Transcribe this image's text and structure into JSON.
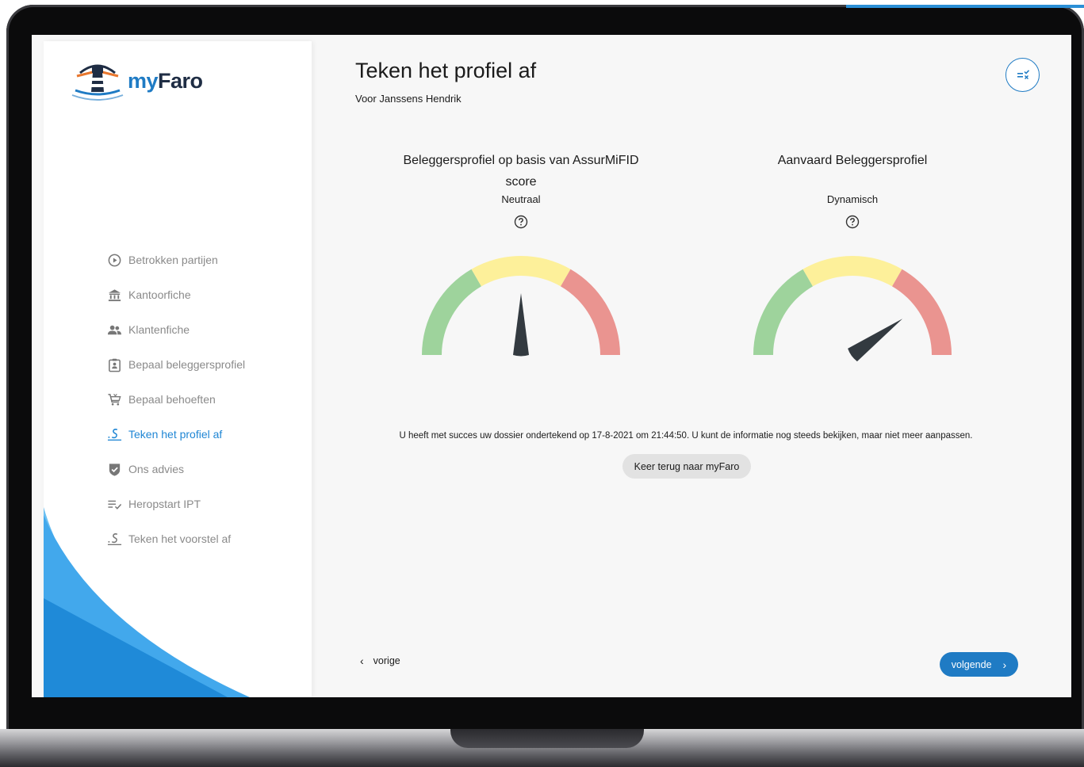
{
  "app": {
    "logo_prefix": "my",
    "logo_suffix": "Faro"
  },
  "sidebar": {
    "items": [
      {
        "label": "Betrokken partijen",
        "icon": "play-circle-icon",
        "active": false
      },
      {
        "label": "Kantoorfiche",
        "icon": "bank-icon",
        "active": false
      },
      {
        "label": "Klantenfiche",
        "icon": "people-icon",
        "active": false
      },
      {
        "label": "Bepaal beleggersprofiel",
        "icon": "clipboard-person-icon",
        "active": false
      },
      {
        "label": "Bepaal behoeften",
        "icon": "cart-icon",
        "active": false
      },
      {
        "label": "Teken het profiel af",
        "icon": "signature-icon",
        "active": true
      },
      {
        "label": "Ons advies",
        "icon": "shield-check-icon",
        "active": false
      },
      {
        "label": "Heropstart IPT",
        "icon": "list-check-icon",
        "active": false
      },
      {
        "label": "Teken het voorstel af",
        "icon": "signature-icon",
        "active": false
      }
    ]
  },
  "header": {
    "title": "Teken het profiel af",
    "subtitle": "Voor Janssens Hendrik",
    "action_icon": "checklist-icon"
  },
  "gauges": [
    {
      "title": "Beleggersprofiel op basis van AssurMiFID score",
      "value": "Neutraal",
      "needle_fraction": 0.5
    },
    {
      "title": "Aanvaard Beleggersprofiel",
      "value": "Dynamisch",
      "needle_fraction": 0.8
    }
  ],
  "colors": {
    "accent": "#1f7bc4",
    "gauge_green": "#9ed39c",
    "gauge_yellow": "#fdf09a",
    "gauge_red": "#ea9490",
    "needle": "#333a40"
  },
  "message": {
    "text": "U heeft met succes uw dossier ondertekend op 17-8-2021 om 21:44:50. U kunt de informatie nog steeds bekijken, maar niet meer aanpassen.",
    "button_label": "Keer terug naar myFaro"
  },
  "footer": {
    "prev_label": "vorige",
    "next_label": "volgende"
  }
}
